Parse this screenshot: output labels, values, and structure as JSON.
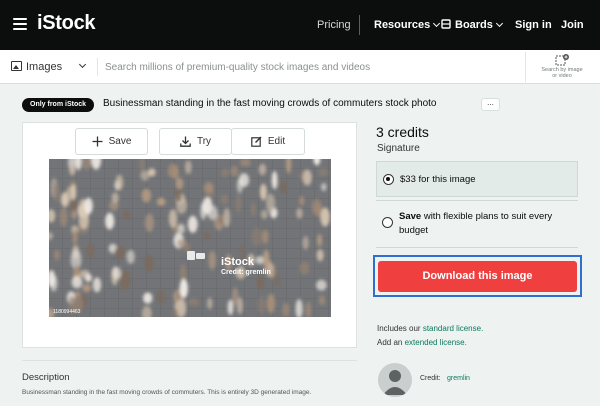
{
  "nav": {
    "logo": "iStock",
    "pricing": "Pricing",
    "resources": "Resources",
    "boards": "Boards",
    "sign_in": "Sign in",
    "join": "Join"
  },
  "search": {
    "type_label": "Images",
    "placeholder": "Search millions of premium-quality stock images and videos",
    "search_by_image_line1": "Search by image",
    "search_by_image_line2": "or video"
  },
  "asset": {
    "badge": "Only from iStock",
    "title": "Businessman standing in the fast moving crowds of commuters stock photo",
    "more": "...",
    "watermark_logo": "iStock",
    "watermark_credit": "Credit: gremlin",
    "image_id": "1180994463"
  },
  "actions": {
    "save": "Save",
    "try": "Try",
    "edit": "Edit"
  },
  "pricing": {
    "credits": "3 credits",
    "tier": "Signature",
    "option1": "$33 for this image",
    "option2_bold": "Save",
    "option2_rest": " with flexible plans to suit every budget",
    "download": "Download this image",
    "license_prefix": "Includes our ",
    "license_link": "standard license.",
    "add_prefix": "Add an ",
    "add_link": "extended license.",
    "credit_label": "Credit:",
    "credit_name": "gremlin"
  },
  "description": {
    "title": "Description",
    "text": "Businessman standing in the fast moving crowds of commuters. This is entirely 3D generated image."
  },
  "colors": {
    "nav_bg": "#0c0d0d",
    "download_button": "#ef3f3f",
    "highlight_frame": "#2e6fd1",
    "link": "#0a7a5c",
    "selected_option_bg": "#e3ebe9"
  }
}
